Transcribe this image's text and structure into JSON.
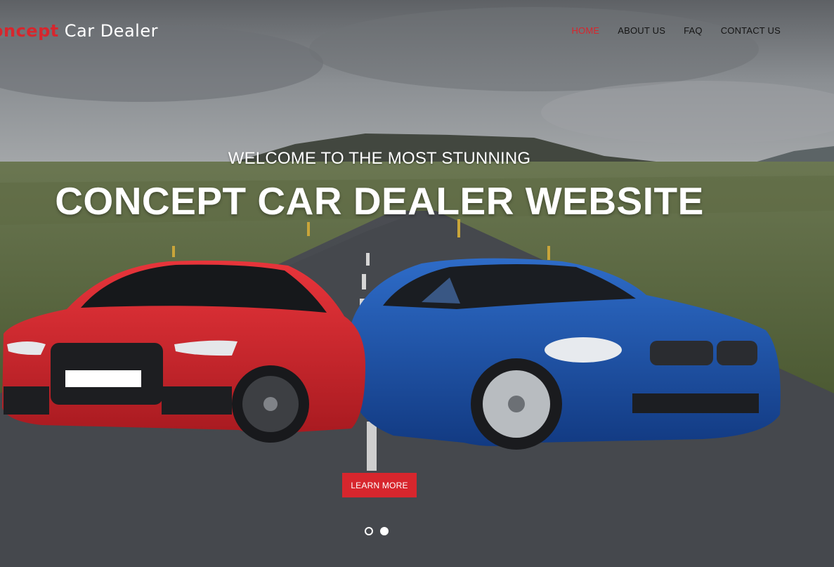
{
  "colors": {
    "accent": "#d7262d",
    "text_dark": "#141414",
    "text_light": "#ffffff"
  },
  "logo": {
    "part1": "oncept",
    "part2": "Car Dealer"
  },
  "nav": {
    "items": [
      {
        "label": "HOME",
        "active": true
      },
      {
        "label": "ABOUT US",
        "active": false
      },
      {
        "label": "FAQ",
        "active": false
      },
      {
        "label": "CONTACT US",
        "active": false
      }
    ]
  },
  "hero": {
    "welcome": "WELCOME TO THE MOST STUNNING",
    "headline": "CONCEPT CAR DEALER WEBSITE",
    "cta_label": "LEARN MORE",
    "slide_count": 2,
    "active_slide": 2
  },
  "icons": [
    "red-sedan-image",
    "blue-coupe-image",
    "road-landscape-image"
  ]
}
